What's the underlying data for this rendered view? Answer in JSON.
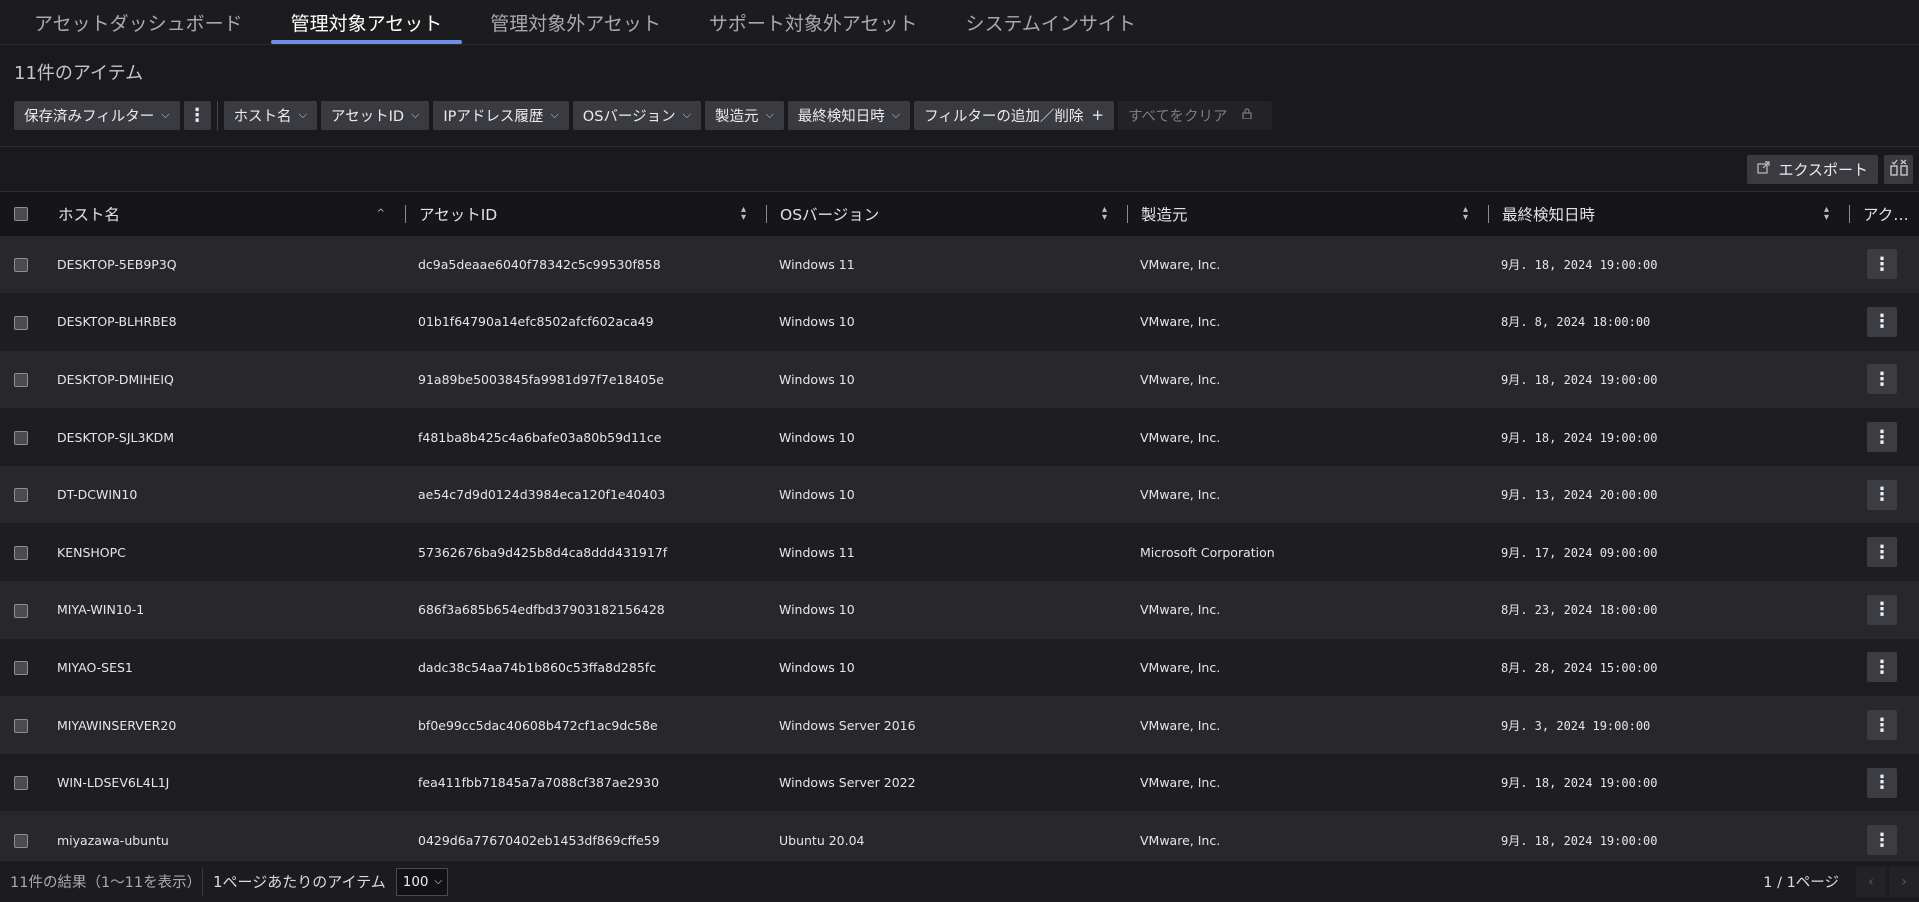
{
  "tabs": [
    {
      "label": "アセットダッシュボード"
    },
    {
      "label": "管理対象アセット"
    },
    {
      "label": "管理対象外アセット"
    },
    {
      "label": "サポート対象外アセット"
    },
    {
      "label": "システムインサイト"
    }
  ],
  "active_tab": 1,
  "item_count": "11件のアイテム",
  "filters": {
    "saved": "保存済みフィルター",
    "host": "ホスト名",
    "asset_id": "アセットID",
    "ip_history": "IPアドレス履歴",
    "os_version": "OSバージョン",
    "manufacturer": "製造元",
    "last_detected": "最終検知日時",
    "add_remove": "フィルターの追加／削除",
    "clear_all": "すべてをクリア"
  },
  "toolbar": {
    "export": "エクスポート"
  },
  "columns": {
    "host": "ホスト名",
    "asset_id": "アセットID",
    "os": "OSバージョン",
    "manufacturer": "製造元",
    "last_detected": "最終検知日時",
    "actions": "アク…"
  },
  "rows": [
    {
      "host": "DESKTOP-5EB9P3Q",
      "asset_id": "dc9a5deaae6040f78342c5c99530f858",
      "os": "Windows 11",
      "manufacturer": "VMware, Inc.",
      "date": "9月. 18, 2024 19:00:00"
    },
    {
      "host": "DESKTOP-BLHRBE8",
      "asset_id": "01b1f64790a14efc8502afcf602aca49",
      "os": "Windows 10",
      "manufacturer": "VMware, Inc.",
      "date": "8月. 8, 2024 18:00:00"
    },
    {
      "host": "DESKTOP-DMIHEIQ",
      "asset_id": "91a89be5003845fa9981d97f7e18405e",
      "os": "Windows 10",
      "manufacturer": "VMware, Inc.",
      "date": "9月. 18, 2024 19:00:00"
    },
    {
      "host": "DESKTOP-SJL3KDM",
      "asset_id": "f481ba8b425c4a6bafe03a80b59d11ce",
      "os": "Windows 10",
      "manufacturer": "VMware, Inc.",
      "date": "9月. 18, 2024 19:00:00"
    },
    {
      "host": "DT-DCWIN10",
      "asset_id": "ae54c7d9d0124d3984eca120f1e40403",
      "os": "Windows 10",
      "manufacturer": "VMware, Inc.",
      "date": "9月. 13, 2024 20:00:00"
    },
    {
      "host": "KENSHOPC",
      "asset_id": "57362676ba9d425b8d4ca8ddd431917f",
      "os": "Windows 11",
      "manufacturer": "Microsoft Corporation",
      "date": "9月. 17, 2024 09:00:00"
    },
    {
      "host": "MIYA-WIN10-1",
      "asset_id": "686f3a685b654edfbd37903182156428",
      "os": "Windows 10",
      "manufacturer": "VMware, Inc.",
      "date": "8月. 23, 2024 18:00:00"
    },
    {
      "host": "MIYAO-SES1",
      "asset_id": "dadc38c54aa74b1b860c53ffa8d285fc",
      "os": "Windows 10",
      "manufacturer": "VMware, Inc.",
      "date": "8月. 28, 2024 15:00:00"
    },
    {
      "host": "MIYAWINSERVER20",
      "asset_id": "bf0e99cc5dac40608b472cf1ac9dc58e",
      "os": "Windows Server 2016",
      "manufacturer": "VMware, Inc.",
      "date": "9月. 3, 2024 19:00:00"
    },
    {
      "host": "WIN-LDSEV6L4L1J",
      "asset_id": "fea411fbb71845a7a7088cf387ae2930",
      "os": "Windows Server 2022",
      "manufacturer": "VMware, Inc.",
      "date": "9月. 18, 2024 19:00:00"
    },
    {
      "host": "miyazawa-ubuntu",
      "asset_id": "0429d6a77670402eb1453df869cffe59",
      "os": "Ubuntu 20.04",
      "manufacturer": "VMware, Inc.",
      "date": "9月. 18, 2024 19:00:00"
    }
  ],
  "footer": {
    "results": "11件の結果（1～11を表示）",
    "items_per_page_label": "1ページあたりのアイテム",
    "items_per_page_value": "100",
    "page_info": "1 / 1ページ"
  },
  "icons": {
    "chevron": "chevron-down-icon",
    "kebab": "kebab-icon",
    "lock": "lock-icon",
    "export": "export-icon",
    "columns": "columns-icon",
    "sort": "sort-icon"
  },
  "colors": {
    "accent": "#6e8fe6",
    "background": "#1a1a1d"
  }
}
